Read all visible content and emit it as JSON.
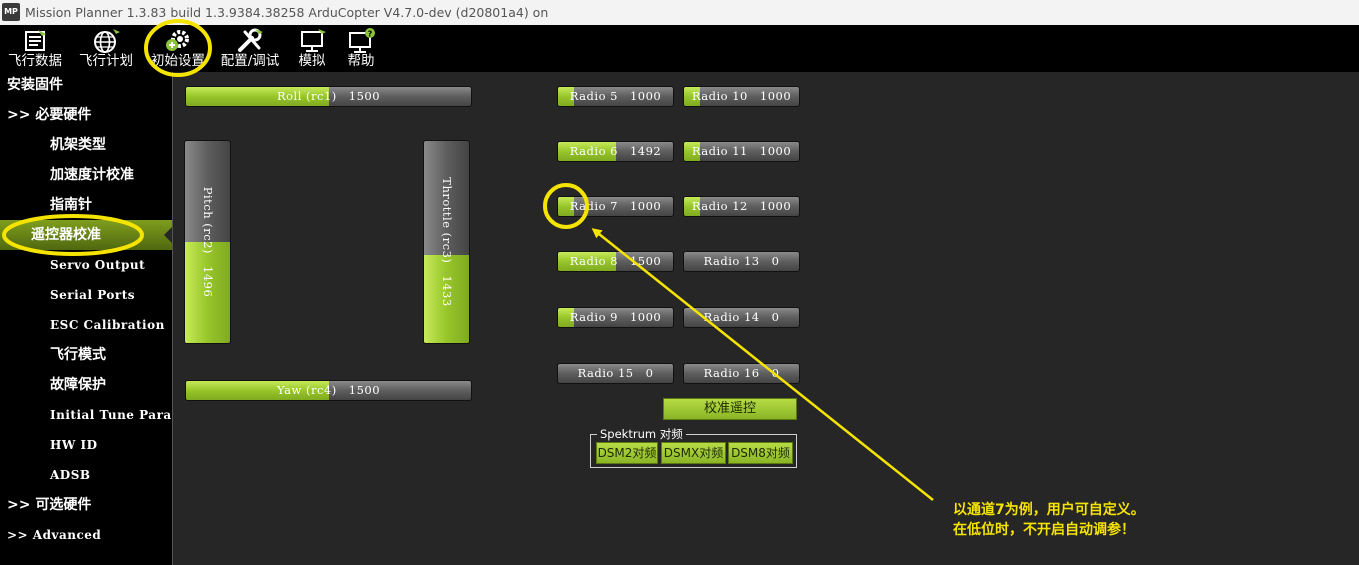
{
  "window": {
    "app_icon_text": "MP",
    "title": "Mission Planner 1.3.83 build 1.3.9384.38258 ArduCopter V4.7.0-dev (d20801a4) on"
  },
  "toolbar": [
    {
      "label": "飞行数据",
      "icon": "flight-data-icon"
    },
    {
      "label": "飞行计划",
      "icon": "flight-plan-icon"
    },
    {
      "label": "初始设置",
      "icon": "initial-setup-icon"
    },
    {
      "label": "配置/调试",
      "icon": "config-tuning-icon"
    },
    {
      "label": "模拟",
      "icon": "simulation-icon"
    },
    {
      "label": "帮助",
      "icon": "help-icon"
    }
  ],
  "sidebar": {
    "items": [
      {
        "label": "安装固件"
      },
      {
        "label": ">> 必要硬件"
      },
      {
        "label": "机架类型"
      },
      {
        "label": "加速度计校准"
      },
      {
        "label": "指南针"
      },
      {
        "label": "遥控器校准"
      },
      {
        "label": "Servo Output"
      },
      {
        "label": "Serial Ports"
      },
      {
        "label": "ESC Calibration"
      },
      {
        "label": "飞行模式"
      },
      {
        "label": "故障保护"
      },
      {
        "label": "Initial Tune Parameters"
      },
      {
        "label": "HW ID"
      },
      {
        "label": "ADSB"
      },
      {
        "label": ">> 可选硬件"
      },
      {
        "label": ">> Advanced"
      }
    ]
  },
  "radio": {
    "roll": {
      "label": "Roll (rc1)",
      "value": "1500",
      "fraction": 0.5
    },
    "pitch": {
      "label": "Pitch (rc2)",
      "value": "1496",
      "fraction": 0.498
    },
    "throttle": {
      "label": "Throttle (rc3)",
      "value": "1433",
      "fraction": 0.435
    },
    "yaw": {
      "label": "Yaw (rc4)",
      "value": "1500",
      "fraction": 0.5
    },
    "channels": [
      {
        "label": "Radio 5",
        "value": "1000",
        "fraction": 0.14
      },
      {
        "label": "Radio 10",
        "value": "1000",
        "fraction": 0.14
      },
      {
        "label": "Radio 6",
        "value": "1492",
        "fraction": 0.5
      },
      {
        "label": "Radio 11",
        "value": "1000",
        "fraction": 0.14
      },
      {
        "label": "Radio 7",
        "value": "1000",
        "fraction": 0.14
      },
      {
        "label": "Radio 12",
        "value": "1000",
        "fraction": 0.14
      },
      {
        "label": "Radio 8",
        "value": "1500",
        "fraction": 0.5
      },
      {
        "label": "Radio 13",
        "value": "0",
        "fraction": 0
      },
      {
        "label": "Radio 9",
        "value": "1000",
        "fraction": 0.14
      },
      {
        "label": "Radio 14",
        "value": "0",
        "fraction": 0
      },
      {
        "label": "Radio 15",
        "value": "0",
        "fraction": 0
      },
      {
        "label": "Radio 16",
        "value": "0",
        "fraction": 0
      }
    ],
    "calibrate_button": "校准遥控",
    "spektrum": {
      "title": "Spektrum 对频",
      "buttons": [
        "DSM2对频",
        "DSMX对频",
        "DSM8对频"
      ]
    }
  },
  "annotation": {
    "line1": "以通道7为例，用户可自定义。",
    "line2": "在低位时，不开启自动调参！",
    "color": "#f5e300"
  }
}
